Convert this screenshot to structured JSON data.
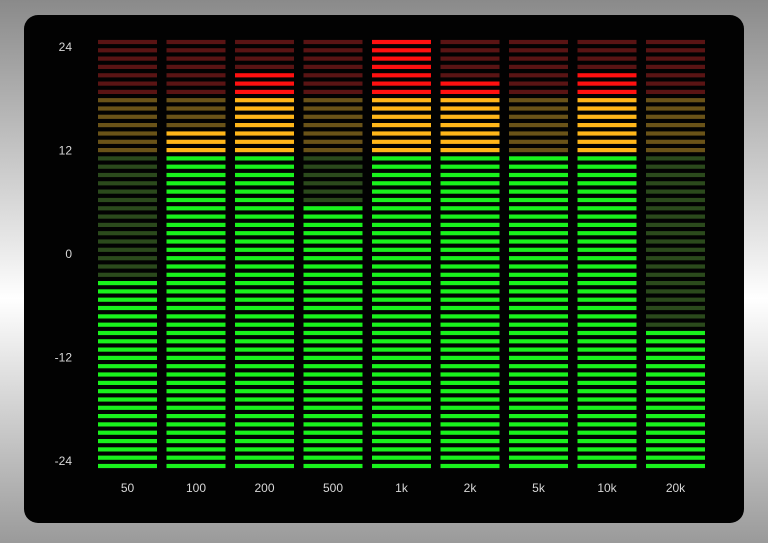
{
  "chart_data": {
    "type": "bar",
    "title": "",
    "xlabel": "",
    "ylabel": "",
    "ylim": [
      -24,
      24
    ],
    "yticks": [
      "24",
      "12",
      "0",
      "-12",
      "-24"
    ],
    "categories": [
      "50",
      "100",
      "200",
      "500",
      "1k",
      "2k",
      "5k",
      "10k",
      "20k"
    ],
    "total_segments": 52,
    "zones": {
      "green_segments": 38,
      "orange_segments": 7,
      "red_segments": 7
    },
    "lit_segments": [
      23,
      41,
      48,
      32,
      52,
      47,
      38,
      48,
      17
    ],
    "colors": {
      "green_on": "#19f21c",
      "green_off": "#2b4a1c",
      "orange_on": "#ffb619",
      "orange_off": "#6a5318",
      "red_on": "#ff1010",
      "red_off": "#5a1414",
      "axis_text": "#d8d8d8"
    }
  }
}
